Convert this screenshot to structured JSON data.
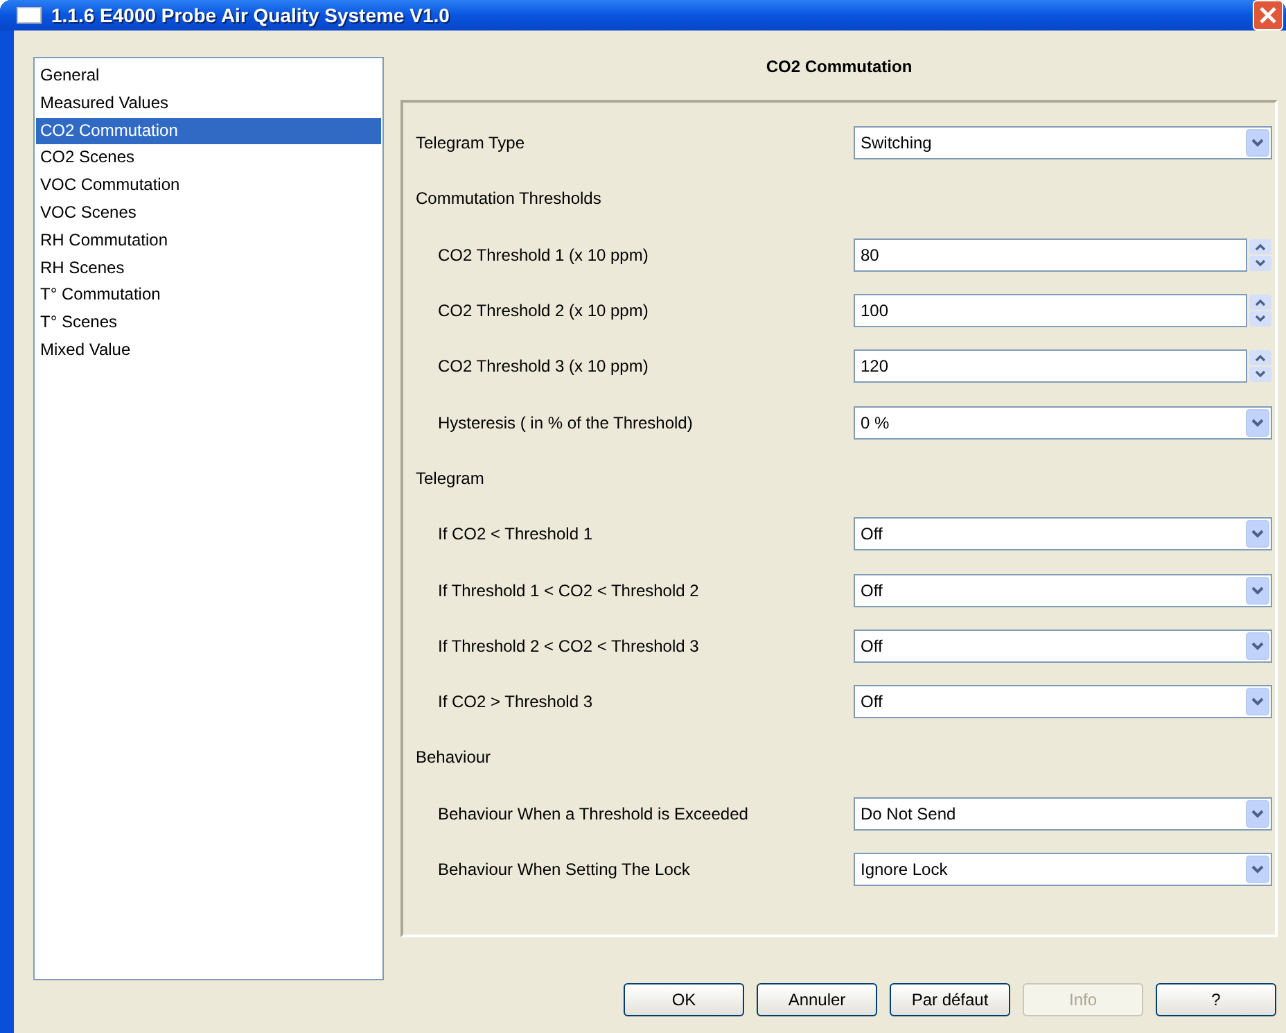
{
  "window": {
    "title": "1.1.6 E4000 Probe Air Quality Systeme V1.0"
  },
  "sidebar": {
    "items": [
      {
        "label": "General",
        "selected": false
      },
      {
        "label": "Measured Values",
        "selected": false
      },
      {
        "label": "CO2 Commutation",
        "selected": true
      },
      {
        "label": "CO2 Scenes",
        "selected": false
      },
      {
        "label": "VOC Commutation",
        "selected": false
      },
      {
        "label": "VOC Scenes",
        "selected": false
      },
      {
        "label": "RH Commutation",
        "selected": false
      },
      {
        "label": "RH Scenes",
        "selected": false
      },
      {
        "label": "T° Commutation",
        "selected": false
      },
      {
        "label": "T° Scenes",
        "selected": false
      },
      {
        "label": "Mixed Value",
        "selected": false
      }
    ]
  },
  "panel": {
    "title": "CO2 Commutation",
    "rows": [
      {
        "kind": "dropdown",
        "label": "Telegram Type",
        "value": "Switching"
      },
      {
        "kind": "heading",
        "label": "Commutation Thresholds",
        "children": [
          {
            "kind": "spin",
            "label": "CO2 Threshold 1 (x 10 ppm)",
            "value": "80"
          },
          {
            "kind": "spin",
            "label": "CO2 Threshold 2 (x 10 ppm)",
            "value": "100"
          },
          {
            "kind": "spin",
            "label": "CO2 Threshold 3 (x 10 ppm)",
            "value": "120"
          },
          {
            "kind": "dropdown",
            "label": "Hysteresis ( in % of the Threshold)",
            "value": "0 %"
          }
        ]
      },
      {
        "kind": "heading",
        "label": "Telegram",
        "children": [
          {
            "kind": "dropdown",
            "label": "If CO2 < Threshold 1",
            "value": "Off"
          },
          {
            "kind": "dropdown",
            "label": "If Threshold 1 < CO2 < Threshold 2",
            "value": "Off"
          },
          {
            "kind": "dropdown",
            "label": "If Threshold 2 < CO2 < Threshold 3",
            "value": "Off"
          },
          {
            "kind": "dropdown",
            "label": "If CO2 > Threshold 3",
            "value": "Off"
          }
        ]
      },
      {
        "kind": "heading",
        "label": "Behaviour",
        "children": [
          {
            "kind": "dropdown",
            "label": "Behaviour When a Threshold is Exceeded",
            "value": "Do Not Send"
          },
          {
            "kind": "dropdown",
            "label": "Behaviour When Setting The Lock",
            "value": "Ignore Lock"
          }
        ]
      }
    ]
  },
  "buttons": [
    {
      "label": "OK",
      "disabled": false
    },
    {
      "label": "Annuler",
      "disabled": false
    },
    {
      "label": "Par défaut",
      "disabled": false
    },
    {
      "label": "Info",
      "disabled": true
    },
    {
      "label": "?",
      "disabled": false
    }
  ]
}
